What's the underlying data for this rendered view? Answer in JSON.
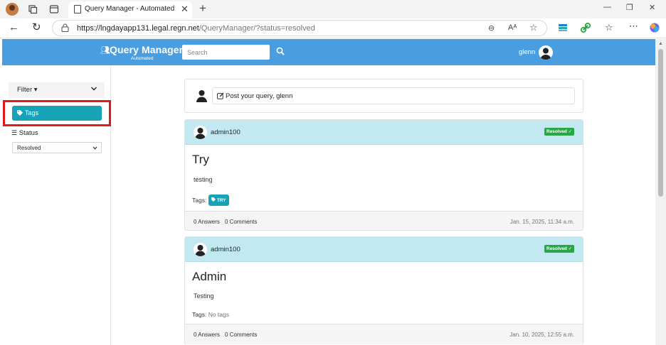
{
  "browser": {
    "tab_title": "Query Manager - Automated",
    "url_host": "https://lngdayapp131.legal.regn.net",
    "url_path": "/QueryManager/?status=resolved",
    "new_tab_label": "+",
    "tab_close_label": "✕"
  },
  "app": {
    "title": "Query Manager",
    "subtitle": "Automated",
    "search_placeholder": "Search",
    "username": "glenn"
  },
  "sidebar": {
    "filter_label": "Filter ▾",
    "tags_label": "Tags",
    "status_label": "Status",
    "status_value": "Resolved"
  },
  "post_box": {
    "placeholder": "Post your query, glenn"
  },
  "queries": [
    {
      "author": "admin100",
      "status_badge": "Resolved ✓",
      "title": "Try",
      "description": "testing",
      "tags_label": "Tags:",
      "tags": [
        "TRY"
      ],
      "answers": "0 Answers",
      "comments": "0 Comments",
      "date": "Jan. 15, 2025, 11:34 a.m."
    },
    {
      "author": "admin100",
      "status_badge": "Resolved ✓",
      "title": "Admin",
      "description": "Testing",
      "tags_label": "Tags:",
      "no_tags": "No tags",
      "answers": "0 Answers",
      "comments": "0 Comments",
      "date": "Jan. 10, 2025, 12:55 a.m."
    }
  ],
  "colors": {
    "appbar": "#4a9ee0",
    "tag": "#17a2b8",
    "resolved": "#28a745",
    "card_header": "#c2e8f2",
    "highlight": "#e01b1b"
  }
}
